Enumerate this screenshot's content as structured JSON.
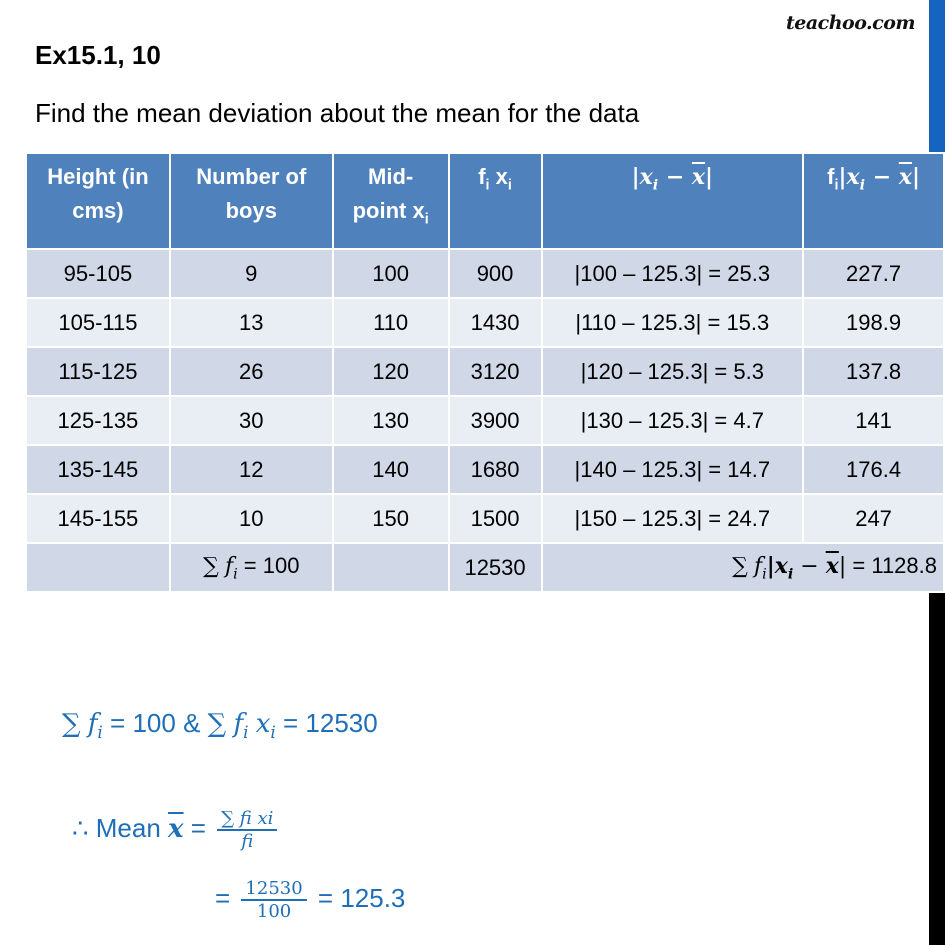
{
  "brand": "teachoo.com",
  "exercise": "Ex15.1,  10",
  "question": "Find the mean deviation about the mean for the data",
  "table": {
    "headers": {
      "height": "Height (in cms)",
      "boys": "Number of boys",
      "mid_a": "Mid-",
      "mid_b": "point x",
      "mid_sub": "i",
      "fx_f": "f",
      "fx_x": " x",
      "sub_i": "i",
      "absdev": "|x",
      "absdev_tail": " − ",
      "xbar": "x",
      "bar_close": "|",
      "f": "f"
    },
    "rows": [
      {
        "height": "95-105",
        "boys": "9",
        "mid": "100",
        "fx": "900",
        "absdev": "|100 – 125.3| = 25.3",
        "fabsdev": "227.7"
      },
      {
        "height": "105-115",
        "boys": "13",
        "mid": "110",
        "fx": "1430",
        "absdev": "|110 – 125.3| = 15.3",
        "fabsdev": "198.9"
      },
      {
        "height": "115-125",
        "boys": "26",
        "mid": "120",
        "fx": "3120",
        "absdev": "|120 – 125.3| = 5.3",
        "fabsdev": "137.8"
      },
      {
        "height": "125-135",
        "boys": "30",
        "mid": "130",
        "fx": "3900",
        "absdev": "|130 – 125.3| = 4.7",
        "fabsdev": "141"
      },
      {
        "height": "135-145",
        "boys": "12",
        "mid": "140",
        "fx": "1680",
        "absdev": "|140 – 125.3| = 14.7",
        "fabsdev": "176.4"
      },
      {
        "height": "145-155",
        "boys": "10",
        "mid": "150",
        "fx": "1500",
        "absdev": "|150 – 125.3| = 24.7",
        "fabsdev": "247"
      }
    ],
    "totals": {
      "sum_symbol": "∑",
      "f": "f",
      "i": "i",
      "sum_f_value": " = 100",
      "sum_fx": "12530",
      "sum_fabs_value": " = 1128.8"
    }
  },
  "solution": {
    "line1": {
      "sum_f_value": " =  100  & ",
      "sum_fx_value": " = 12530"
    },
    "line2": {
      "therefore": "∴",
      "mean_label": " Mean ",
      "eq": " = ",
      "num": "∑ fi xi",
      "den": "fi"
    },
    "line3": {
      "eq": "= ",
      "num": "12530",
      "den": "100",
      "result": " = 125.3"
    }
  },
  "colors": {
    "header_bg": "#4f81bd",
    "row_dark": "#d0d8e8",
    "row_light": "#e9edf4",
    "solution_text": "#1f6fb8",
    "sidebar": "#000000",
    "sidebar_thumb": "#1565c0"
  }
}
